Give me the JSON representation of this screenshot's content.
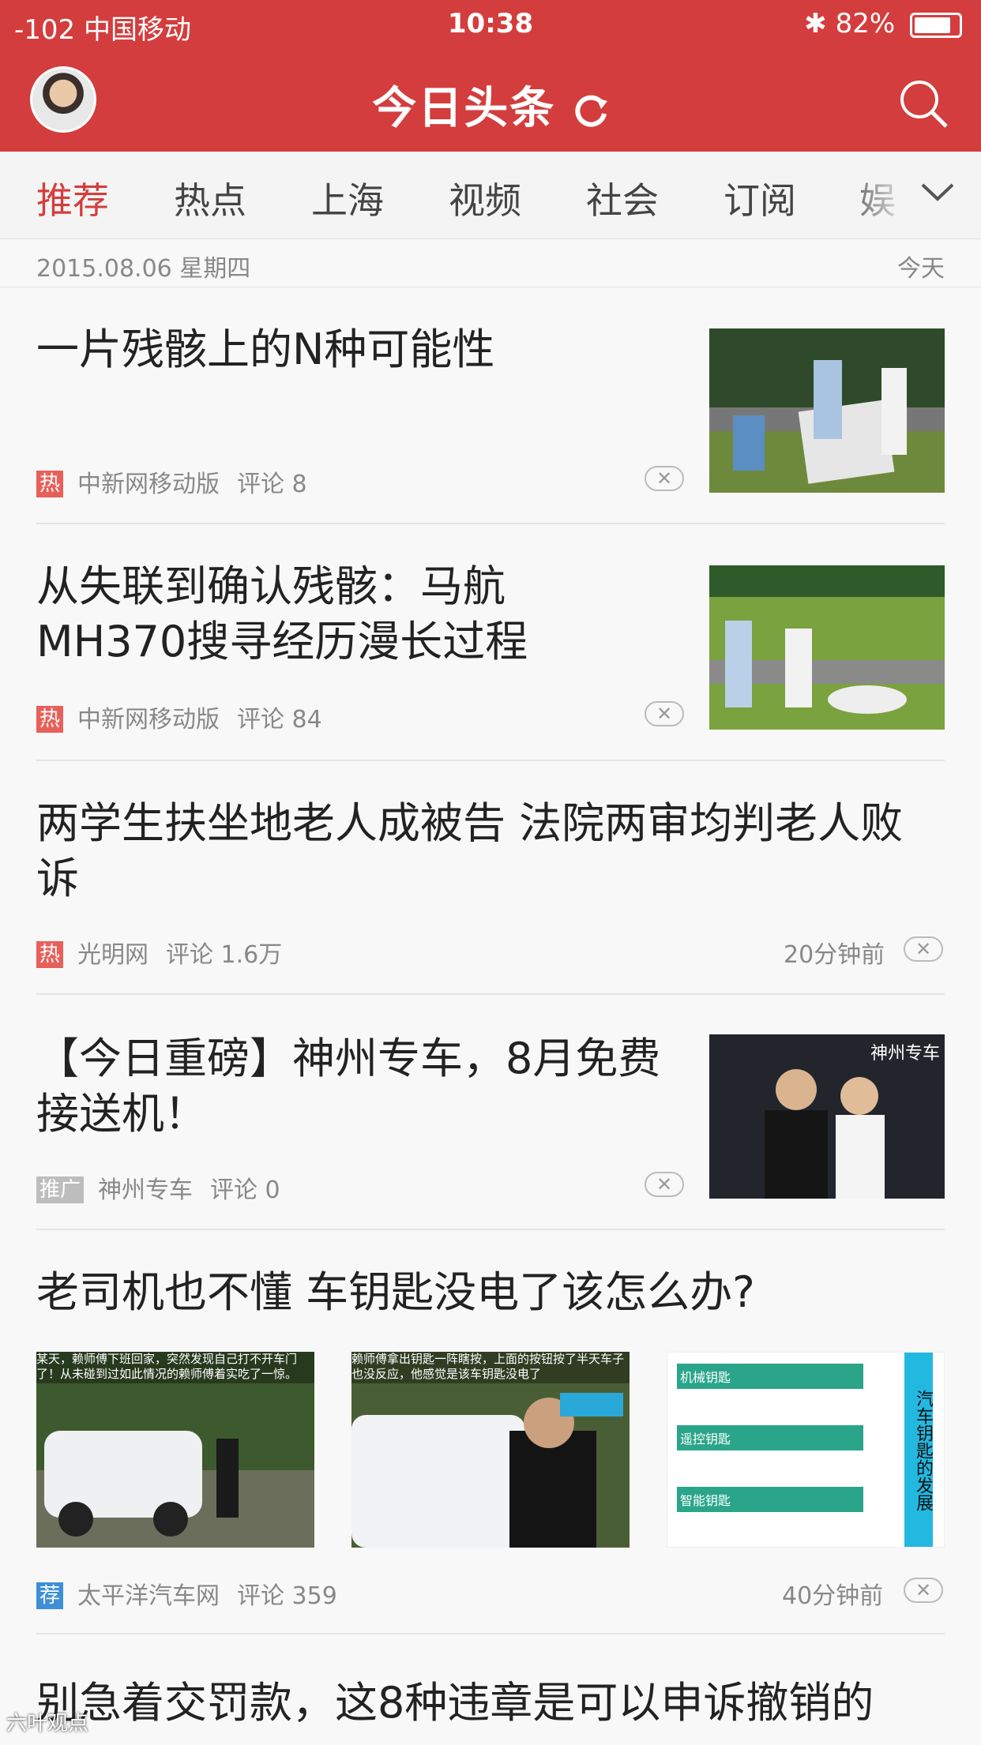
{
  "status_bar": {
    "carrier": "-102 中国移动",
    "time": "10:38",
    "battery": "82%",
    "battery_level": 0.82
  },
  "header": {
    "logo": "今日头条"
  },
  "tabs": [
    "推荐",
    "热点",
    "上海",
    "视频",
    "社会",
    "订阅",
    "娱"
  ],
  "datebar": {
    "date": "2015.08.06 星期四",
    "today": "今天"
  },
  "colors": {
    "brand": "#d43d3d",
    "hot_tag": "#e8605a",
    "ad_tag": "#bdbdbd",
    "rec_tag": "#3d8fd6"
  },
  "feed": [
    {
      "title": "一片残骸上的N种可能性",
      "tag": "热",
      "source": "中新网移动版",
      "comments": "评论 8",
      "has_thumb": true
    },
    {
      "title": "从失联到确认残骸：马航MH370搜寻经历漫长过程",
      "tag": "热",
      "source": "中新网移动版",
      "comments": "评论 84",
      "has_thumb": true
    },
    {
      "title": "两学生扶坐地老人成被告 法院两审均判老人败诉",
      "tag": "热",
      "source": "光明网",
      "comments": "评论 1.6万",
      "time": "20分钟前"
    },
    {
      "title": "【今日重磅】神州专车，8月免费接送机！",
      "tag": "推广",
      "source": "神州专车",
      "comments": "评论 0",
      "has_thumb": true,
      "thumb_text": "神州专车"
    },
    {
      "title": "老司机也不懂 车钥匙没电了该怎么办?",
      "tag": "荐",
      "source": "太平洋汽车网",
      "comments": "评论 359",
      "time": "40分钟前",
      "image_captions": [
        "某天，赖师傅下班回家，突然发现自己打不开车门了！从未碰到过如此情况的赖师傅着实吃了一惊。",
        "赖师傅拿出钥匙一阵瞎按，上面的按钮按了半天车子也没反应，他感觉是该车钥匙没电了",
        "汽车钥匙的发展"
      ],
      "key_types": [
        "机械钥匙",
        "遥控钥匙",
        "智能钥匙"
      ]
    },
    {
      "title": "别急着交罚款，这8种违章是可以申诉撤销的"
    }
  ],
  "close_glyph": "✕",
  "watermark": "六叶观点"
}
